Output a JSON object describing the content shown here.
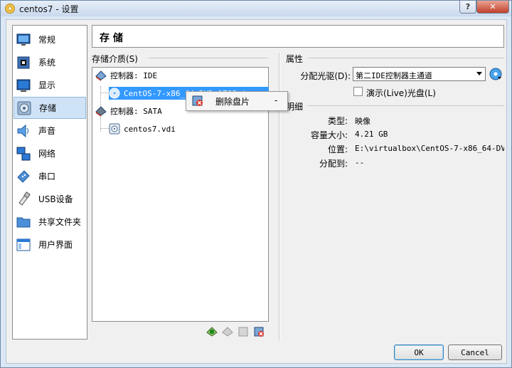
{
  "window": {
    "title": "centos7 - 设置",
    "help_label": "?",
    "close_label": "✕"
  },
  "sidebar": {
    "items": [
      {
        "label": "常规",
        "icon": "monitor-icon"
      },
      {
        "label": "系统",
        "icon": "chip-icon"
      },
      {
        "label": "显示",
        "icon": "display-icon"
      },
      {
        "label": "存储",
        "icon": "disc-icon",
        "selected": true
      },
      {
        "label": "声音",
        "icon": "speaker-icon"
      },
      {
        "label": "网络",
        "icon": "network-icon"
      },
      {
        "label": "串口",
        "icon": "serial-port-icon"
      },
      {
        "label": "USB设备",
        "icon": "usb-icon"
      },
      {
        "label": "共享文件夹",
        "icon": "folder-icon"
      },
      {
        "label": "用户界面",
        "icon": "window-icon"
      }
    ]
  },
  "page": {
    "title": "存 储"
  },
  "storage": {
    "section_label": "存储介质(S)",
    "tree": {
      "ide_controller": "控制器: IDE",
      "ide_disc": "CentOS-7-x86_64-DVD-1708.iso",
      "sata_controller": "控制器: SATA",
      "sata_disk": "centos7.vdi"
    }
  },
  "attributes": {
    "section_label": "属性",
    "drive_label": "分配光驱(D):",
    "drive_value": "第二IDE控制器主通道",
    "live_cd_label": "演示(Live)光盘(L)",
    "live_cd_checked": false
  },
  "details": {
    "section_label": "明细",
    "type_key": "类型:",
    "type_value": "映像",
    "size_key": "容量大小:",
    "size_value": "4.21 GB",
    "location_key": "位置:",
    "location_value": "E:\\virtualbox\\CentOS-7-x86_64-DV…",
    "attached_key": "分配到:",
    "attached_value": "--"
  },
  "context_menu": {
    "item_label": "删除盘片",
    "shortcut": "-"
  },
  "buttons": {
    "ok": "OK",
    "cancel": "Cancel"
  },
  "colors": {
    "selection": "#3399ff",
    "window_frame": "#dbe7f4",
    "close_button": "#c2402a"
  }
}
